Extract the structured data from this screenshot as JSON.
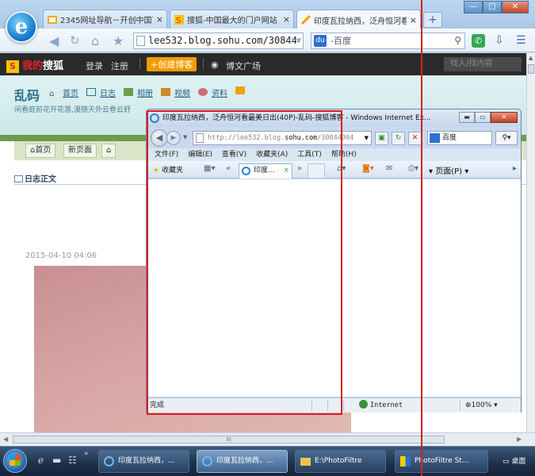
{
  "browser": {
    "logo_letter": "e",
    "tabs": [
      {
        "label": "2345网址导航－开创中国百",
        "active": false
      },
      {
        "label": "搜狐-中国最大的门户网站",
        "active": false
      },
      {
        "label": "印度瓦拉纳西，泛舟恒河看",
        "active": true
      }
    ],
    "tab_close": "×",
    "newtab_label": "+",
    "address": "lee532.blog.sohu.com/30844",
    "search_engine_icon": "baidu-icon",
    "search_placeholder": "-百度",
    "window_controls": {
      "min": "—",
      "max": "□",
      "close": "✕"
    }
  },
  "sohu_bar": {
    "logo": "搜狐",
    "logo_prefix": "我的",
    "login": "登录",
    "register": "注册",
    "create_blog": "+创建博客",
    "plaza": "博文广场",
    "find_placeholder": "找人/找内容"
  },
  "blog": {
    "title": "乱码",
    "nav": [
      "首页",
      "日志",
      "相册",
      "视频",
      "资料"
    ],
    "subtitle": "闲看庭前花开花落,漫随天外云卷云舒",
    "menu": [
      "首页",
      "新页面"
    ],
    "section_title": "日志正文",
    "post_date": "2015-04-10 04:06",
    "scroll_thumb": "III"
  },
  "ie_window": {
    "title": "印度瓦拉纳西，泛舟恒河看最美日出(40P)-乱码-搜狐博客 - Windows Internet Ex...",
    "address_gray": "http://lee532.blog.",
    "address_dark": "sohu.com",
    "address_rest": "/30844904",
    "search_text": "百度",
    "menu": [
      "文件(F)",
      "编辑(E)",
      "查看(V)",
      "收藏夹(A)",
      "工具(T)",
      "帮助(H)"
    ],
    "favorites": "收藏夹",
    "tab_label": "印度...",
    "page_menu": "页面(P)",
    "status_done": "完成",
    "status_zone": "Internet",
    "zoom": "100%"
  },
  "taskbar": {
    "buttons": [
      {
        "label": "印度瓦拉纳西，...",
        "active": false
      },
      {
        "label": "印度瓦拉纳西，...",
        "active": true
      },
      {
        "label": "E:\\PhotoFiltre",
        "active": false
      },
      {
        "label": "PhotoFiltre St...",
        "active": false
      }
    ],
    "desktop": "桌面"
  },
  "colors": {
    "highlight": "#d62020",
    "brand_orange": "#f59b00",
    "sohu_red": "#e4242b"
  }
}
